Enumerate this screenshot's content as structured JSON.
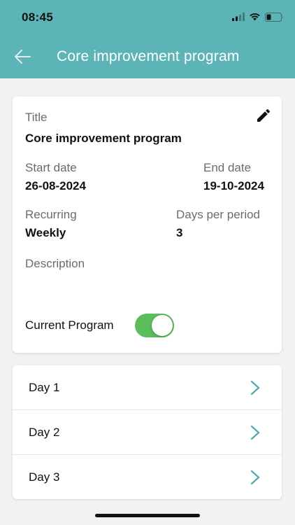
{
  "status_bar": {
    "time": "08:45",
    "icons": [
      "signal-icon",
      "wifi-icon",
      "battery-icon"
    ]
  },
  "header": {
    "title": "Core improvement program",
    "back_icon": "arrow-left-icon",
    "background_color": "#5db4b7"
  },
  "program": {
    "title_label": "Title",
    "title_value": "Core improvement program",
    "edit_icon": "pencil-icon",
    "start_date_label": "Start date",
    "start_date_value": "26-08-2024",
    "end_date_label": "End date",
    "end_date_value": "19-10-2024",
    "recurring_label": "Recurring",
    "recurring_value": "Weekly",
    "days_per_period_label": "Days per period",
    "days_per_period_value": "3",
    "description_label": "Description",
    "current_program_label": "Current Program",
    "current_program_enabled": true,
    "toggle_color": "#5cbd5c"
  },
  "days": [
    {
      "label": "Day 1"
    },
    {
      "label": "Day 2"
    },
    {
      "label": "Day 3"
    }
  ],
  "chevron_color": "#4fa7b3"
}
